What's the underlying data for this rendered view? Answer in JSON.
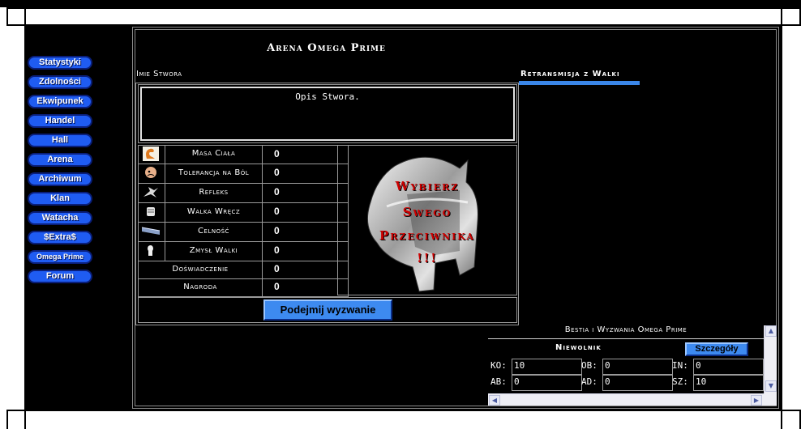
{
  "nav": {
    "items": [
      {
        "label": "Statystyki"
      },
      {
        "label": "Zdolności"
      },
      {
        "label": "Ekwipunek"
      },
      {
        "label": "Handel"
      },
      {
        "label": "Hall"
      },
      {
        "label": "Arena"
      },
      {
        "label": "Archiwum"
      },
      {
        "label": "Klan"
      },
      {
        "label": "Watacha"
      },
      {
        "label": "$Extra$"
      },
      {
        "label": "Omega Prime"
      },
      {
        "label": "Forum"
      }
    ]
  },
  "arena": {
    "title": "Arena Omega Prime",
    "creature_name_label": "Imie Stwora",
    "description": "Opis Stwora.",
    "challenge_button": "Podejmij wyzwanie",
    "helmet_overlay": [
      "Wybierz",
      "Swego",
      "Przeciwnika",
      "!!!"
    ]
  },
  "stats": [
    {
      "icon": "muscle-icon",
      "label": "Masa Ciała",
      "value": "0"
    },
    {
      "icon": "pain-tolerance-icon",
      "label": "Tolerancja na Ból",
      "value": "0"
    },
    {
      "icon": "reflex-icon",
      "label": "Refleks",
      "value": "0"
    },
    {
      "icon": "fist-icon",
      "label": "Walka Wręcz",
      "value": "0"
    },
    {
      "icon": "accuracy-icon",
      "label": "Celność",
      "value": "0"
    },
    {
      "icon": "combat-sense-icon",
      "label": "Zmysł Walki",
      "value": "0"
    },
    {
      "icon": "",
      "label": "Doświadczenie",
      "value": "0"
    },
    {
      "icon": "",
      "label": "Nagroda",
      "value": "0"
    }
  ],
  "broadcast": {
    "tab_label": "Retransmisja z Walki"
  },
  "beast_panel": {
    "title": "Bestia i Wyzwania Omega Prime",
    "name": "Niewolnik",
    "details_button": "Szczegóły",
    "fields": [
      {
        "label": "KO:",
        "value": "10"
      },
      {
        "label": "OB:",
        "value": "0"
      },
      {
        "label": "IN:",
        "value": "0"
      },
      {
        "label": "AB:",
        "value": "0"
      },
      {
        "label": "AD:",
        "value": "0"
      },
      {
        "label": "SZ:",
        "value": "10"
      }
    ]
  },
  "colors": {
    "nav_button": "#1f5cf2",
    "challenge_button": "#3d8af0",
    "broadcast_underline": "#3a86e8",
    "overlay_text": "#cc0000"
  }
}
